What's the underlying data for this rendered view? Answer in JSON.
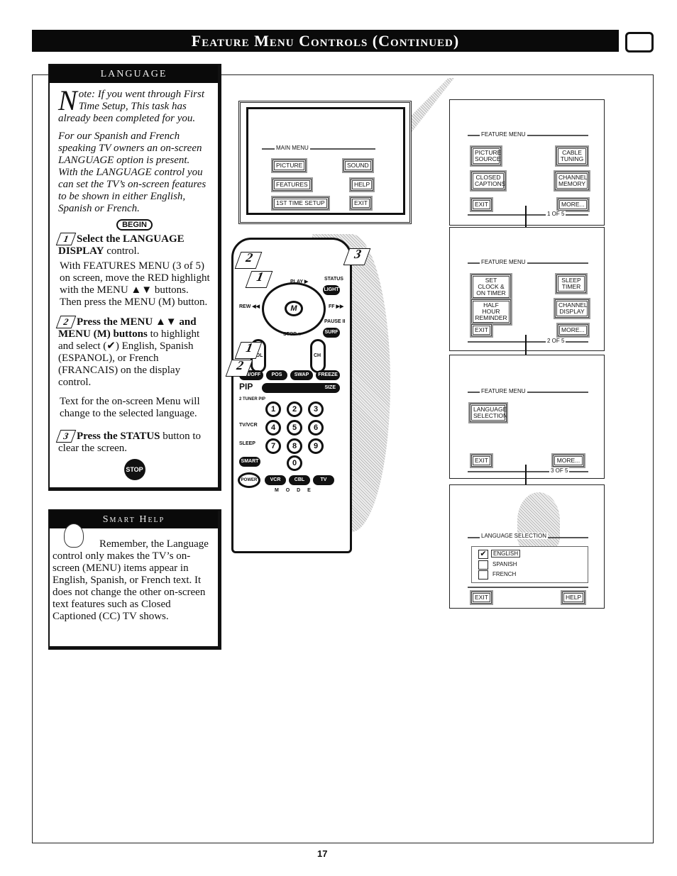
{
  "header": {
    "title": "Feature Menu Controls (Continued)"
  },
  "language": {
    "heading": "LANGUAGE",
    "note_initial": "N",
    "note": "ote: If you went through First Time Setup, This task has already been completed for you.",
    "intro": "For our Spanish and French speaking TV owners an on-screen LANGUAGE option is present. With the LANGUAGE control you can set the TV’s on-screen features to be shown in either English, Spanish or French.",
    "begin": "BEGIN",
    "steps": [
      {
        "num": "1",
        "title": "Select the LANGUAGE DISPLAY",
        "title_rest": " control.",
        "body": "With FEATURES MENU (3 of 5) on screen, move the RED highlight with the MENU ▲▼ buttons. Then press the MENU (M) button."
      },
      {
        "num": "2",
        "title": "Press the MENU ▲▼ and MENU (M) buttons",
        "title_rest": " to highlight and select (✔) English, Spanish (ESPANOL), or French (FRANCAIS) on the display control.",
        "body": "Text for the on-screen Menu will change to the selected language."
      },
      {
        "num": "3",
        "title": "Press the STATUS",
        "title_rest": " button to clear the screen.",
        "body": ""
      }
    ],
    "stop": "STOP"
  },
  "smart_help": {
    "heading": "Smart Help",
    "text": "Remember, the Language control only makes the TV’s on-screen (MENU) items appear in English, Spanish, or French text. It does not change the other on-screen text features such as Closed Captioned (CC) TV shows."
  },
  "main_menu": {
    "title": "MAIN MENU",
    "items": [
      "PICTURE",
      "SOUND",
      "FEATURES",
      "HELP",
      "1ST TIME SETUP",
      "EXIT"
    ]
  },
  "feature_menus": [
    {
      "title": "FEATURE MENU",
      "items": [
        "PICTURE SOURCE",
        "CABLE TUNING",
        "CLOSED CAPTIONS",
        "CHANNEL MEMORY",
        "EXIT",
        "MORE..."
      ],
      "page": "1 OF 5"
    },
    {
      "title": "FEATURE MENU",
      "items": [
        "SET CLOCK & ON TIMER",
        "SLEEP TIMER",
        "HALF HOUR REMINDER",
        "CHANNEL DISPLAY",
        "EXIT",
        "MORE..."
      ],
      "page": "2 OF 5"
    },
    {
      "title": "FEATURE MENU",
      "items": [
        "LANGUAGE SELECTION",
        "EXIT",
        "MORE..."
      ],
      "page": "3 OF 5"
    }
  ],
  "language_selection": {
    "title": "LANGUAGE SELECTION",
    "options": [
      {
        "label": "ENGLISH",
        "checked": true
      },
      {
        "label": "SPANISH",
        "checked": false
      },
      {
        "label": "FRENCH",
        "checked": false
      }
    ],
    "exit": "EXIT",
    "help": "HELP"
  },
  "remote": {
    "play": "PLAY ▶",
    "status": "STATUS",
    "light": "LIGHT",
    "rew": "REW ◀◀",
    "ff": "FF ▶▶",
    "pause": "PAUSE II",
    "surf": "SURF",
    "stop": "STOP ■",
    "menu": "M",
    "vol": "VOL",
    "ch": "CH",
    "pip_row": [
      "ON/OFF",
      "POS",
      "SWAP",
      "FREEZE"
    ],
    "pip": "PIP",
    "size": "SIZE",
    "two_tuner": "2 TUNER PIP",
    "tvvcr": "TV/VCR",
    "sleep": "SLEEP",
    "smart": "SMART",
    "power": "POWER",
    "modes": [
      "VCR",
      "CBL",
      "TV"
    ],
    "mode_label": "M O D E",
    "digits": [
      "1",
      "2",
      "3",
      "4",
      "5",
      "6",
      "7",
      "8",
      "9",
      "0"
    ],
    "callouts": [
      "2",
      "1",
      "3",
      "1",
      "2"
    ]
  },
  "footer": {
    "page_number": "17"
  }
}
